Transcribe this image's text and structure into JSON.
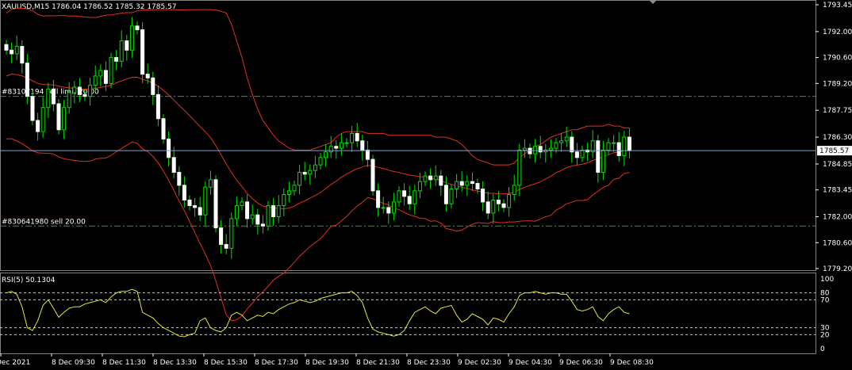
{
  "header": {
    "symbol_line": "XAUUSD,M15  1786.04 1786.52 1785.32 1785.57"
  },
  "price_labels": [
    "1793.45",
    "1792.00",
    "1790.60",
    "1789.20",
    "1787.75",
    "1786.30",
    "1784.85",
    "1783.45",
    "1782.00",
    "1780.60",
    "1779.20"
  ],
  "current_price": "1785.57",
  "orders": [
    {
      "label": "#83107194  sell limit 20.00",
      "price": 1788.5
    },
    {
      "label": "#830641980 sell 20.00",
      "price": 1781.5
    }
  ],
  "rsi": {
    "label": "RSI(5) 50.1304",
    "levels": [
      "100",
      "80",
      "70",
      "30",
      "20",
      "0"
    ]
  },
  "time_labels": [
    "Dec 2021",
    "8 Dec 09:30",
    "8 Dec 11:30",
    "8 Dec 13:30",
    "8 Dec 15:30",
    "8 Dec 17:30",
    "8 Dec 19:30",
    "8 Dec 21:30",
    "8 Dec 23:30",
    "9 Dec 02:30",
    "9 Dec 04:30",
    "9 Dec 06:30",
    "9 Dec 08:30"
  ],
  "chart_data": {
    "type": "candlestick",
    "symbol": "XAUUSD",
    "timeframe": "M15",
    "ylim": [
      1779.2,
      1793.45
    ],
    "close": [
      1791.0,
      1790.8,
      1791.2,
      1790.3,
      1788.5,
      1787.2,
      1786.6,
      1787.9,
      1788.9,
      1788.1,
      1786.7,
      1787.9,
      1788.7,
      1789.0,
      1788.6,
      1788.5,
      1789.1,
      1789.6,
      1789.9,
      1789.2,
      1790.6,
      1790.4,
      1791.5,
      1791.0,
      1792.3,
      1792.1,
      1789.7,
      1789.5,
      1788.6,
      1787.3,
      1786.2,
      1785.2,
      1784.4,
      1783.7,
      1782.9,
      1782.6,
      1782.5,
      1782.1,
      1783.6,
      1784.0,
      1781.4,
      1780.5,
      1780.3,
      1781.9,
      1782.6,
      1782.8,
      1781.9,
      1782.1,
      1781.6,
      1781.5,
      1782.6,
      1782.0,
      1782.6,
      1783.2,
      1783.4,
      1783.7,
      1784.4,
      1784.3,
      1784.5,
      1784.8,
      1785.2,
      1785.5,
      1785.8,
      1785.7,
      1786.0,
      1786.0,
      1786.5,
      1786.1,
      1785.6,
      1785.1,
      1783.4,
      1782.5,
      1782.5,
      1782.2,
      1782.8,
      1783.4,
      1783.1,
      1782.7,
      1783.4,
      1783.9,
      1784.2,
      1784.0,
      1784.2,
      1783.7,
      1782.7,
      1783.5,
      1783.9,
      1783.7,
      1783.9,
      1783.8,
      1783.5,
      1782.8,
      1782.2,
      1782.9,
      1782.7,
      1782.5,
      1783.2,
      1783.7,
      1785.6,
      1785.7,
      1785.4,
      1785.8,
      1785.5,
      1785.6,
      1785.7,
      1786.0,
      1786.1,
      1786.3,
      1785.5,
      1785.2,
      1785.6,
      1785.5,
      1786.1,
      1784.4,
      1785.6,
      1786.0,
      1786.0,
      1785.3,
      1786.3,
      1785.57
    ],
    "bb_upper": [
      1793.0,
      1793.2,
      1793.25,
      1793.27,
      1793.22,
      1793.12,
      1792.94,
      1792.84,
      1792.86,
      1792.85,
      1792.87,
      1792.87,
      1792.84,
      1792.85,
      1792.82,
      1792.79,
      1792.77,
      1792.76,
      1792.82,
      1792.89,
      1792.9,
      1792.95,
      1793.0,
      1793.02,
      1793.02,
      1793.12,
      1793.17,
      1793.17,
      1793.18,
      1793.19,
      1793.19,
      1793.19,
      1793.18,
      1793.17,
      1793.17,
      1793.18,
      1793.19,
      1793.19,
      1793.19,
      1793.19,
      1793.16,
      1793.1,
      1793.0,
      1792.4,
      1791.5,
      1790.6,
      1789.5,
      1788.6,
      1787.8,
      1787.2,
      1786.8,
      1786.4,
      1786.1,
      1785.9,
      1785.7,
      1785.6,
      1785.6,
      1785.6,
      1785.6,
      1785.7,
      1785.8,
      1785.9,
      1786.0,
      1786.3,
      1786.5,
      1786.6,
      1786.6,
      1786.6,
      1786.6,
      1786.5,
      1786.5,
      1786.5,
      1786.5,
      1786.4,
      1786.4,
      1786.4,
      1786.4,
      1786.4,
      1786.4,
      1786.4,
      1786.4,
      1786.4,
      1786.3,
      1786.3,
      1786.3,
      1786.2,
      1786.1,
      1785.9,
      1785.6,
      1785.3,
      1785.1,
      1785.0,
      1784.9,
      1784.8,
      1784.8,
      1784.8,
      1784.8,
      1784.9,
      1785.2,
      1785.4,
      1785.6,
      1785.8,
      1785.9,
      1786.1,
      1786.3,
      1786.4,
      1786.5,
      1786.6,
      1786.7,
      1786.7,
      1786.8,
      1786.9,
      1786.9,
      1786.9,
      1786.9,
      1787.0,
      1786.9,
      1786.9,
      1786.8,
      1786.8
    ],
    "bb_middle": [
      1789.6,
      1789.71,
      1789.67,
      1789.61,
      1789.49,
      1789.34,
      1789.2,
      1789.14,
      1789.14,
      1789.12,
      1789.05,
      1789.0,
      1788.96,
      1788.95,
      1788.91,
      1788.89,
      1788.89,
      1788.94,
      1788.99,
      1789.03,
      1789.11,
      1789.23,
      1789.34,
      1789.44,
      1789.53,
      1789.54,
      1789.42,
      1789.34,
      1789.22,
      1789.05,
      1788.83,
      1788.58,
      1788.3,
      1788.01,
      1787.75,
      1787.46,
      1787.17,
      1786.87,
      1786.59,
      1786.28,
      1785.85,
      1785.36,
      1784.85,
      1784.39,
      1783.97,
      1783.62,
      1783.26,
      1782.97,
      1782.74,
      1782.57,
      1782.52,
      1782.49,
      1782.44,
      1782.43,
      1782.47,
      1782.57,
      1782.73,
      1782.86,
      1783.0,
      1783.15,
      1783.31,
      1783.52,
      1783.74,
      1783.92,
      1784.14,
      1784.31,
      1784.46,
      1784.59,
      1784.69,
      1784.77,
      1784.74,
      1784.67,
      1784.61,
      1784.52,
      1784.44,
      1784.39,
      1784.32,
      1784.25,
      1784.21,
      1784.16,
      1784.15,
      1784.08,
      1784.04,
      1783.98,
      1783.83,
      1783.75,
      1783.66,
      1783.59,
      1783.52,
      1783.45,
      1783.39,
      1783.33,
      1783.27,
      1783.27,
      1783.24,
      1783.24,
      1783.26,
      1783.31,
      1783.48,
      1783.59,
      1783.69,
      1783.78,
      1783.89,
      1784.05,
      1784.19,
      1784.38,
      1784.5,
      1784.65,
      1784.74,
      1784.79,
      1784.84,
      1784.91,
      1785.04,
      1785.14,
      1785.24,
      1785.35,
      1785.46,
      1785.49,
      1785.57,
      1785.6
    ],
    "bb_lower": [
      1786.2,
      1786.22,
      1786.09,
      1785.95,
      1785.76,
      1785.56,
      1785.46,
      1785.44,
      1785.42,
      1785.39,
      1785.23,
      1785.13,
      1785.08,
      1785.05,
      1785.0,
      1784.99,
      1785.01,
      1785.12,
      1785.16,
      1785.17,
      1785.32,
      1785.51,
      1785.68,
      1785.86,
      1786.04,
      1785.96,
      1785.67,
      1785.51,
      1785.26,
      1784.91,
      1784.47,
      1783.97,
      1783.42,
      1782.85,
      1782.33,
      1781.74,
      1781.15,
      1780.55,
      1779.99,
      1779.37,
      1778.54,
      1777.62,
      1776.7,
      1776.38,
      1776.44,
      1776.64,
      1777.02,
      1777.34,
      1777.68,
      1777.94,
      1778.24,
      1778.58,
      1778.78,
      1778.96,
      1779.24,
      1779.54,
      1779.86,
      1780.12,
      1780.4,
      1780.6,
      1780.82,
      1781.14,
      1781.48,
      1781.54,
      1781.78,
      1782.02,
      1782.32,
      1782.58,
      1782.78,
      1783.04,
      1782.98,
      1782.84,
      1782.72,
      1782.64,
      1782.48,
      1782.38,
      1782.24,
      1782.1,
      1782.02,
      1781.92,
      1781.9,
      1781.76,
      1781.78,
      1781.66,
      1781.36,
      1781.3,
      1781.22,
      1781.28,
      1781.44,
      1781.6,
      1781.68,
      1781.66,
      1781.64,
      1781.74,
      1781.68,
      1781.68,
      1781.72,
      1781.72,
      1781.76,
      1781.78,
      1781.78,
      1781.76,
      1781.88,
      1782.0,
      1782.08,
      1782.36,
      1782.5,
      1782.7,
      1782.78,
      1782.88,
      1782.88,
      1782.92,
      1783.18,
      1783.38,
      1783.58,
      1783.7,
      1784.02,
      1784.08,
      1784.34,
      1784.4
    ],
    "rsi_values": [
      80,
      82,
      78,
      60,
      30,
      26,
      40,
      62,
      70,
      58,
      45,
      52,
      58,
      60,
      60,
      64,
      66,
      68,
      70,
      66,
      74,
      80,
      82,
      82,
      85,
      82,
      52,
      48,
      44,
      36,
      30,
      26,
      22,
      18,
      17,
      20,
      22,
      40,
      44,
      30,
      26,
      24,
      30,
      48,
      52,
      48,
      40,
      44,
      48,
      46,
      52,
      50,
      56,
      60,
      64,
      66,
      70,
      68,
      66,
      68,
      72,
      74,
      76,
      78,
      80,
      80,
      82,
      76,
      66,
      44,
      28,
      24,
      22,
      20,
      18,
      20,
      26,
      40,
      52,
      56,
      60,
      54,
      50,
      58,
      60,
      62,
      48,
      38,
      42,
      50,
      46,
      42,
      34,
      44,
      42,
      38,
      50,
      60,
      76,
      80,
      80,
      82,
      80,
      78,
      80,
      80,
      78,
      78,
      68,
      56,
      54,
      56,
      60,
      46,
      40,
      50,
      56,
      60,
      52,
      50
    ],
    "rsi_ylim": [
      0,
      100
    ],
    "rsi_levels": [
      30,
      70
    ]
  }
}
